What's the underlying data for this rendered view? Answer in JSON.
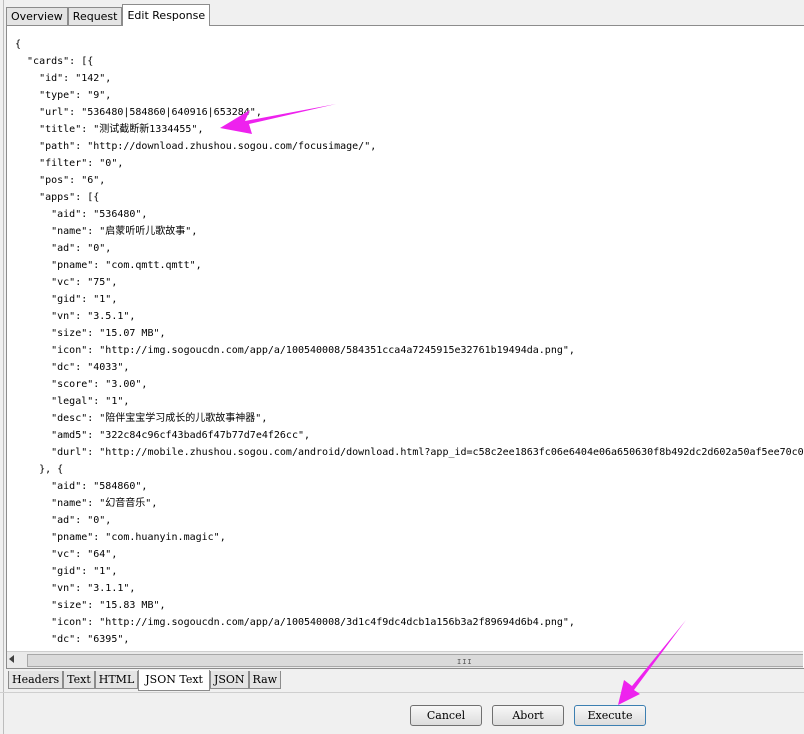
{
  "top_tabs": [
    "Overview",
    "Request",
    "Edit Response"
  ],
  "json_lines": [
    "{",
    "  \"cards\": [{",
    "    \"id\": \"142\",",
    "    \"type\": \"9\",",
    "    \"url\": \"536480|584860|640916|653284\",",
    "    \"title\": \"测试截断新1334455\",",
    "    \"path\": \"http://download.zhushou.sogou.com/focusimage/\",",
    "    \"filter\": \"0\",",
    "    \"pos\": \"6\",",
    "    \"apps\": [{",
    "      \"aid\": \"536480\",",
    "      \"name\": \"启蒙听听儿歌故事\",",
    "      \"ad\": \"0\",",
    "      \"pname\": \"com.qmtt.qmtt\",",
    "      \"vc\": \"75\",",
    "      \"gid\": \"1\",",
    "      \"vn\": \"3.5.1\",",
    "      \"size\": \"15.07 MB\",",
    "      \"icon\": \"http://img.sogoucdn.com/app/a/100540008/584351cca4a7245915e32761b19494da.png\",",
    "      \"dc\": \"4033\",",
    "      \"score\": \"3.00\",",
    "      \"legal\": \"1\",",
    "      \"desc\": \"陪伴宝宝学习成长的儿歌故事神器\",",
    "      \"amd5\": \"322c84c96cf43bad6f47b77d7e4f26cc\",",
    "      \"durl\": \"http://mobile.zhushou.sogou.com/android/download.html?app_id=c58c2ee1863fc06e6404e06a650630f8b492dc2d602a50af5ee70c0b",
    "    }, {",
    "      \"aid\": \"584860\",",
    "      \"name\": \"幻音音乐\",",
    "      \"ad\": \"0\",",
    "      \"pname\": \"com.huanyin.magic\",",
    "      \"vc\": \"64\",",
    "      \"gid\": \"1\",",
    "      \"vn\": \"3.1.1\",",
    "      \"size\": \"15.83 MB\",",
    "      \"icon\": \"http://img.sogoucdn.com/app/a/100540008/3d1c4f9dc4dcb1a156b3a2f89694d6b4.png\",",
    "      \"dc\": \"6395\","
  ],
  "bottom_tabs": [
    "Headers",
    "Text",
    "HTML",
    "JSON Text",
    "JSON",
    "Raw"
  ],
  "buttons": {
    "cancel": "Cancel",
    "abort": "Abort",
    "execute": "Execute"
  },
  "colors": {
    "annotation_arrow": "#ee22ee",
    "execute_border": "#3c7fb1"
  },
  "scroll_grip": "III"
}
